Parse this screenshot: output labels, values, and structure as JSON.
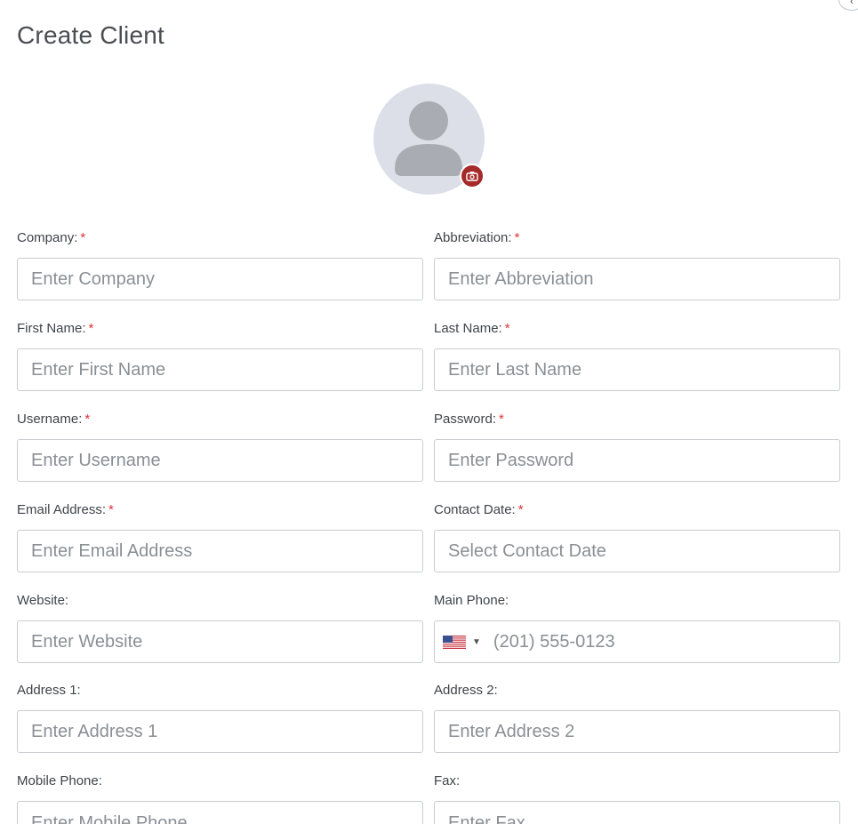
{
  "page": {
    "title": "Create Client"
  },
  "avatar": {
    "icon": "user-avatar-icon",
    "upload_icon": "camera-icon",
    "accent": "#a52a2a"
  },
  "fields": {
    "company": {
      "label": "Company:",
      "required": "*",
      "placeholder": "Enter Company"
    },
    "abbreviation": {
      "label": "Abbreviation:",
      "required": "*",
      "placeholder": "Enter Abbreviation"
    },
    "first_name": {
      "label": "First Name:",
      "required": "*",
      "placeholder": "Enter First Name"
    },
    "last_name": {
      "label": "Last Name:",
      "required": "*",
      "placeholder": "Enter Last Name"
    },
    "username": {
      "label": "Username:",
      "required": "*",
      "placeholder": "Enter Username"
    },
    "password": {
      "label": "Password:",
      "required": "*",
      "placeholder": "Enter Password"
    },
    "email": {
      "label": "Email Address:",
      "required": "*",
      "placeholder": "Enter Email Address"
    },
    "contact_date": {
      "label": "Contact Date:",
      "required": "*",
      "placeholder": "Select Contact Date"
    },
    "website": {
      "label": "Website:",
      "placeholder": "Enter Website"
    },
    "main_phone": {
      "label": "Main Phone:",
      "placeholder": "(201) 555-0123",
      "country_flag": "us-flag-icon"
    },
    "address1": {
      "label": "Address 1:",
      "placeholder": "Enter Address 1"
    },
    "address2": {
      "label": "Address 2:",
      "placeholder": "Enter Address 2"
    },
    "mobile_phone": {
      "label": "Mobile Phone:",
      "placeholder": "Enter Mobile Phone"
    },
    "fax": {
      "label": "Fax:",
      "placeholder": "Enter Fax"
    }
  },
  "colors": {
    "required_marker": "#e0343a",
    "input_border": "#c9ccd0",
    "placeholder": "#8a8f95"
  }
}
